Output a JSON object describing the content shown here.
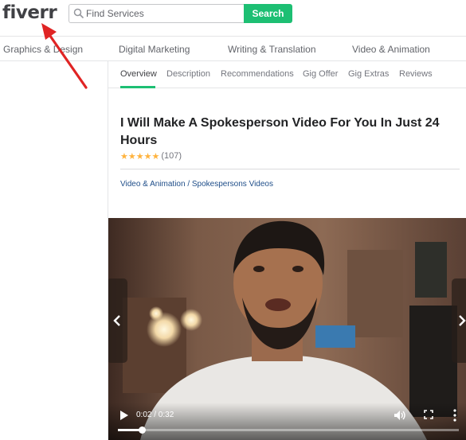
{
  "header": {
    "logo": "fiverr",
    "search_placeholder": "Find Services",
    "search_button": "Search"
  },
  "categories": [
    {
      "label": "Graphics & Design"
    },
    {
      "label": "Digital Marketing"
    },
    {
      "label": "Writing & Translation"
    },
    {
      "label": "Video & Animation"
    }
  ],
  "tabs": [
    {
      "label": "Overview",
      "active": true
    },
    {
      "label": "Description"
    },
    {
      "label": "Recommendations"
    },
    {
      "label": "Gig Offer"
    },
    {
      "label": "Gig Extras"
    },
    {
      "label": "Reviews"
    }
  ],
  "gig": {
    "title": "I Will Make A Spokesperson Video For You In Just 24 Hours",
    "stars": "★★★★★",
    "rating_count": "(107)",
    "breadcrumb": "Video & Animation / Spokespersons Videos"
  },
  "player": {
    "time": "0:02 / 0:32",
    "progress": 0.07
  },
  "icons": {
    "search": "search-icon",
    "play": "play-icon",
    "volume": "volume-icon",
    "fullscreen": "fullscreen-icon",
    "more": "more-vertical-icon",
    "prev": "chevron-left-icon",
    "next": "chevron-right-icon"
  },
  "colors": {
    "brand_green": "#1dbf73",
    "star": "#ffb33e",
    "link": "#1f4e89",
    "annotation_red": "#e02424"
  }
}
